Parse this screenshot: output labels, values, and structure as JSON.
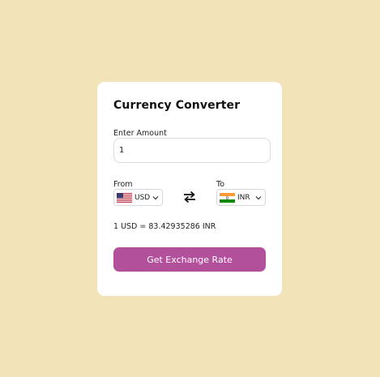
{
  "converter": {
    "title": "Currency Converter",
    "amount_label": "Enter Amount",
    "amount_value": "1",
    "from_label": "From",
    "to_label": "To",
    "from_currency": "USD",
    "to_currency": "INR",
    "from_flag_icon": "us-flag-icon",
    "to_flag_icon": "india-flag-icon",
    "swap_icon": "swap-arrows-icon",
    "result_text": "1 USD = 83.42935286 INR",
    "button_label": "Get Exchange Rate"
  },
  "colors": {
    "background": "#f3e3b8",
    "card": "#ffffff",
    "button": "#b3509c",
    "button_text": "#ffffff"
  }
}
